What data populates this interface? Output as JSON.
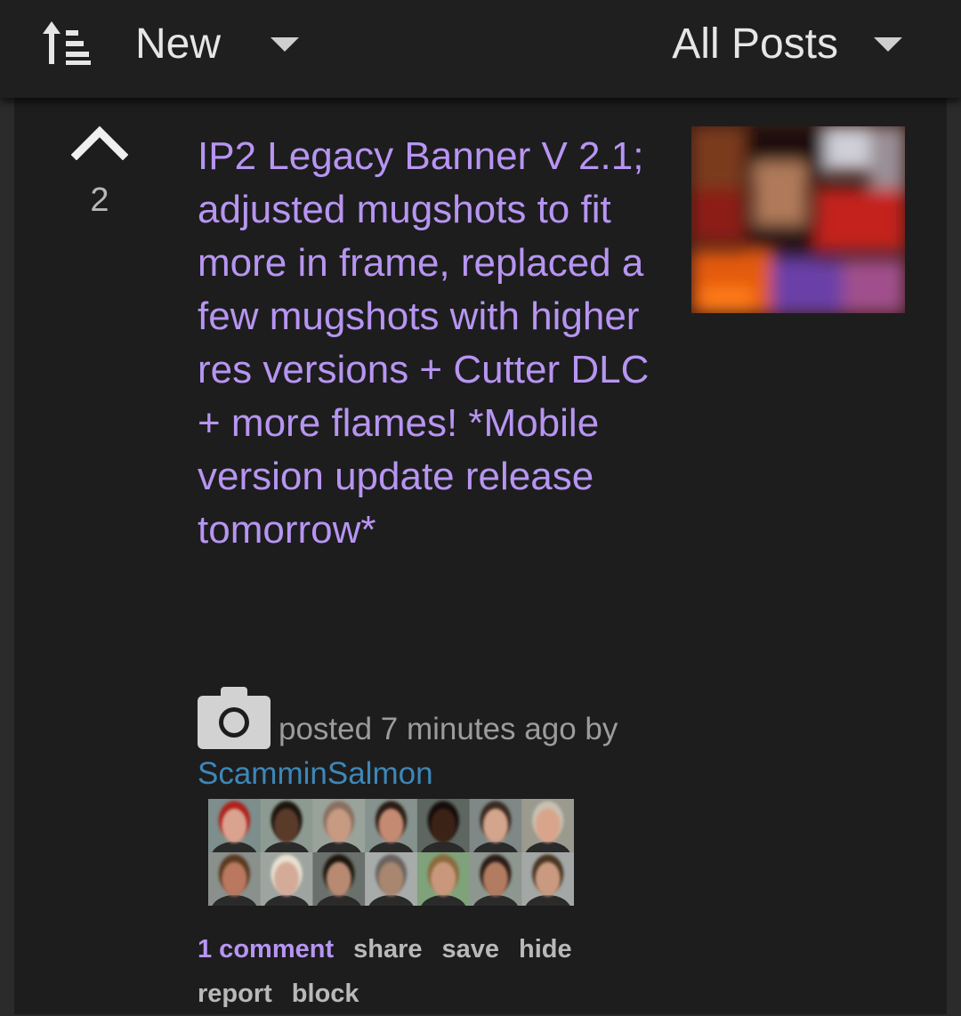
{
  "toolbar": {
    "sort_icon": "sort-ascending-icon",
    "sort_label": "New",
    "filter_label": "All Posts",
    "dropdown_icon": "caret-down-icon"
  },
  "post": {
    "upvote_icon": "chevron-up-icon",
    "score": "2",
    "title": "IP2 Legacy Banner V 2.1; adjusted mugshots to fit more in frame, replaced a few mugshots with higher res versions + Cutter DLC + more flames! *Mobile version update release tomorrow*",
    "post_type_icon": "camera-icon",
    "meta": "posted 7 minutes ago by",
    "author": "ScamminSalmon",
    "actions": {
      "comments": "1 comment",
      "share": "share",
      "save": "save",
      "hide": "hide",
      "report": "report",
      "block": "block"
    }
  },
  "colors": {
    "title": "#b795f2",
    "author": "#3d87b8",
    "background": "#1d1d1d",
    "topbar": "#1f1f1f"
  }
}
